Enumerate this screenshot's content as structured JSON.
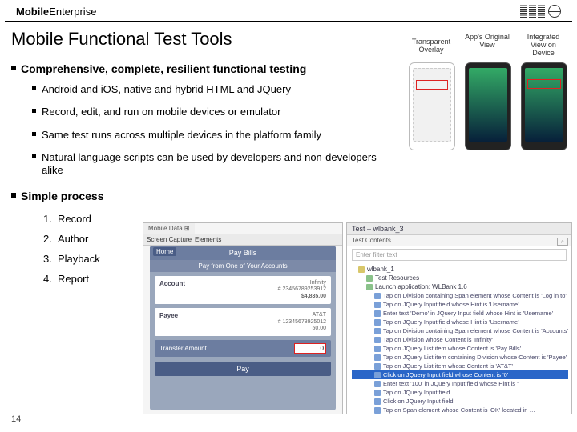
{
  "header": {
    "brand_bold": "Mobile",
    "brand_light": "Enterprise",
    "logo": "IBM"
  },
  "title": "Mobile Functional Test Tools",
  "section1": {
    "heading": "Comprehensive, complete, resilient functional testing",
    "items": [
      "Android and iOS, native and hybrid HTML and JQuery",
      "Record, edit, and run on mobile devices or emulator",
      "Same test runs across multiple devices in the platform family",
      "Natural language scripts can be used by developers and non-developers alike"
    ]
  },
  "section2": {
    "heading": "Simple process",
    "steps": [
      "Record",
      "Author",
      "Playback",
      "Report"
    ]
  },
  "phones": {
    "labels": [
      "Transparent Overlay",
      "App's Original View",
      "Integrated View on Device"
    ]
  },
  "mockapp": {
    "tab": "Mobile Data ⊞",
    "toolbar": [
      "Screen Capture",
      "Elements"
    ],
    "nav_title": "Pay Bills",
    "home": "Home",
    "subhead": "Pay from One of Your Accounts",
    "rows": [
      {
        "k": "Account",
        "v1": "Infinity",
        "v2": "# 23456789253912",
        "v3": "$4,835.00"
      },
      {
        "k": "Payee",
        "v1": "AT&T",
        "v2": "# 12345678925012",
        "v3": "50.00"
      }
    ],
    "transfer_label": "Transfer Amount",
    "transfer_value": "0",
    "pay": "Pay"
  },
  "mocktree": {
    "tab": "Test – wlbank_3",
    "sub": "Test Contents",
    "filter_placeholder": "Enter filter text",
    "find": "⌕",
    "nodes": [
      {
        "lvl": 0,
        "txt": "wlbank_1",
        "ico": "y"
      },
      {
        "lvl": 1,
        "txt": "Test Resources",
        "ico": "g"
      },
      {
        "lvl": 1,
        "txt": "Launch application: WLBank 1.6",
        "ico": "g"
      },
      {
        "lvl": 2,
        "txt": "Tap on Division containing Span element whose Content is 'Log in to'"
      },
      {
        "lvl": 2,
        "txt": "Tap on JQuery Input field whose Hint is 'Username'"
      },
      {
        "lvl": 2,
        "txt": "Enter text 'Demo' in JQuery Input field whose Hint is 'Username'"
      },
      {
        "lvl": 2,
        "txt": "Tap on JQuery Input field whose Hint is 'Username'"
      },
      {
        "lvl": 2,
        "txt": "Tap on Division containing Span element whose Content is 'Accounts'"
      },
      {
        "lvl": 2,
        "txt": "Tap on Division whose Content is 'Infinity'"
      },
      {
        "lvl": 2,
        "txt": "Tap on JQuery List item whose Content is 'Pay Bills'"
      },
      {
        "lvl": 2,
        "txt": "Tap on JQuery List item containing Division whose Content is 'Payee'"
      },
      {
        "lvl": 2,
        "txt": "Tap on JQuery List item whose Content is 'AT&T'"
      },
      {
        "lvl": 2,
        "txt": "Click on JQuery Input field whose Content is '0'",
        "sel": true
      },
      {
        "lvl": 2,
        "txt": "Enter text '100' in JQuery Input field whose Hint is ''"
      },
      {
        "lvl": 2,
        "txt": "Tap on JQuery Input field"
      },
      {
        "lvl": 2,
        "txt": "Click on JQuery Input field"
      },
      {
        "lvl": 2,
        "txt": "Tap on Span element whose Content is 'OK' located in …"
      }
    ]
  },
  "page_number": "14"
}
